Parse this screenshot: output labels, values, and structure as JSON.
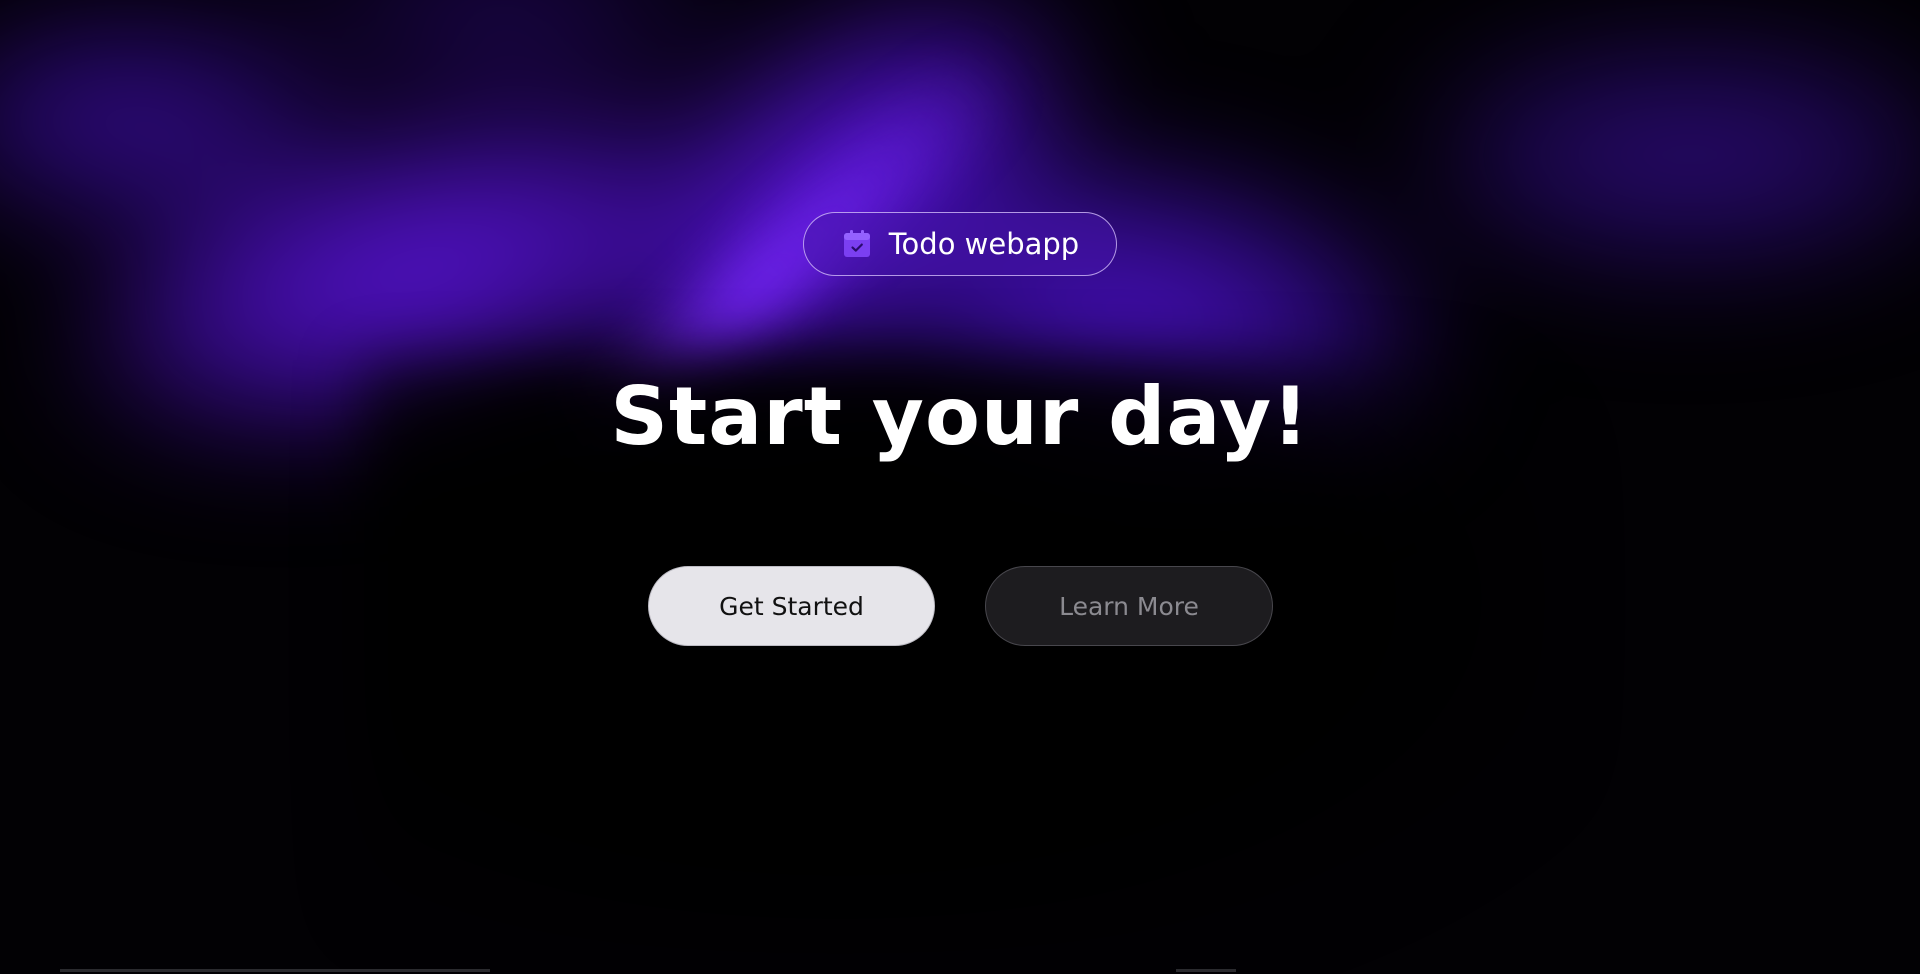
{
  "badge": {
    "icon": "calendar-check-icon",
    "label": "Todo webapp",
    "icon_color": "#7b3ff2"
  },
  "hero": {
    "headline": "Start your day!"
  },
  "actions": {
    "primary_label": "Get Started",
    "secondary_label": "Learn More"
  },
  "theme": {
    "accent": "#6a1ff0",
    "background": "#020104"
  }
}
